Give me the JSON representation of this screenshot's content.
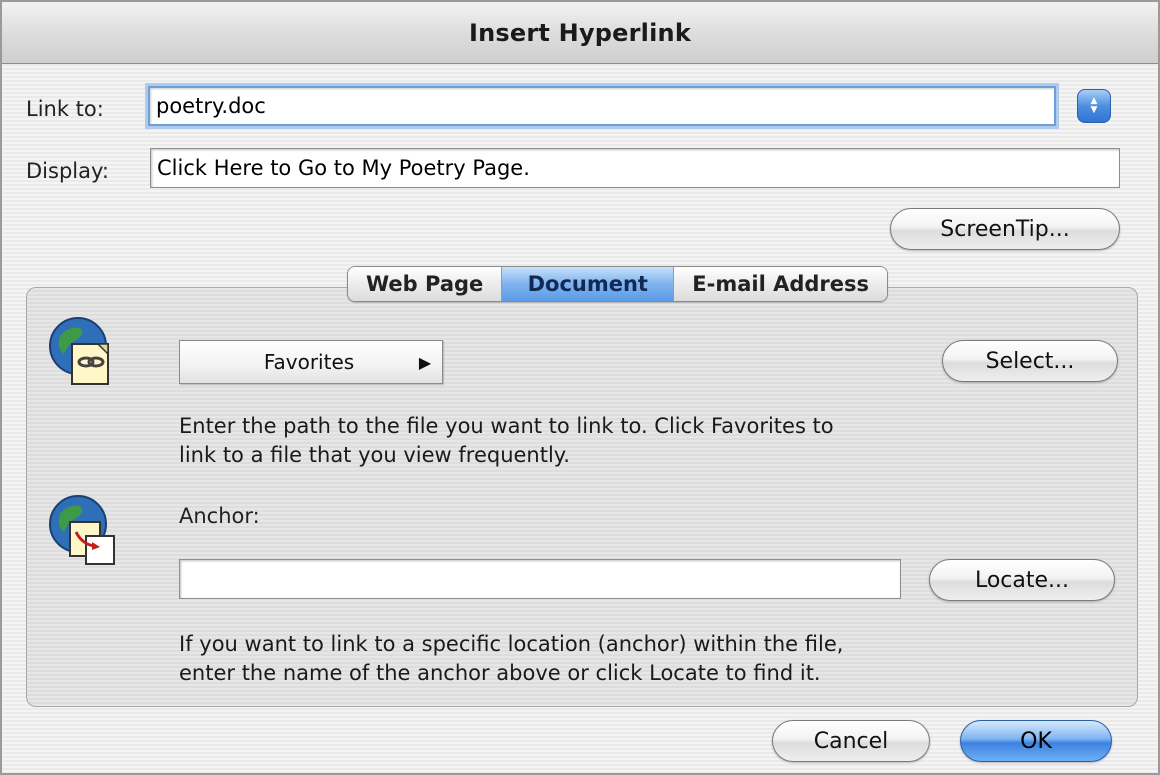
{
  "window": {
    "title": "Insert Hyperlink"
  },
  "link_to": {
    "label": "Link to:",
    "value": "poetry.doc"
  },
  "display": {
    "label": "Display:",
    "value": "Click Here to Go to My Poetry Page."
  },
  "buttons": {
    "screentip": "ScreenTip...",
    "select": "Select...",
    "locate": "Locate...",
    "cancel": "Cancel",
    "ok": "OK"
  },
  "tabs": [
    {
      "label": "Web Page",
      "active": false
    },
    {
      "label": "Document",
      "active": true
    },
    {
      "label": "E-mail Address",
      "active": false
    }
  ],
  "document_tab": {
    "favorites_label": "Favorites",
    "help_path_line1": "Enter the path to the file you want to link to. Click Favorites to",
    "help_path_line2": "link to a file that you view frequently.",
    "anchor_label": "Anchor:",
    "anchor_value": "",
    "help_anchor_line1": "If you want to link to a specific location (anchor) within the file,",
    "help_anchor_line2": "enter the name of the anchor above or click Locate to find it."
  },
  "colors": {
    "accent": "#4f8fe0",
    "focus_ring": "#aecbee"
  },
  "icons": {
    "link_type_popup": "up-down-arrows-icon",
    "file_globe": "globe-document-link-icon",
    "anchor_globe": "globe-document-anchor-icon",
    "favorites_arrow": "triangle-right-icon"
  }
}
